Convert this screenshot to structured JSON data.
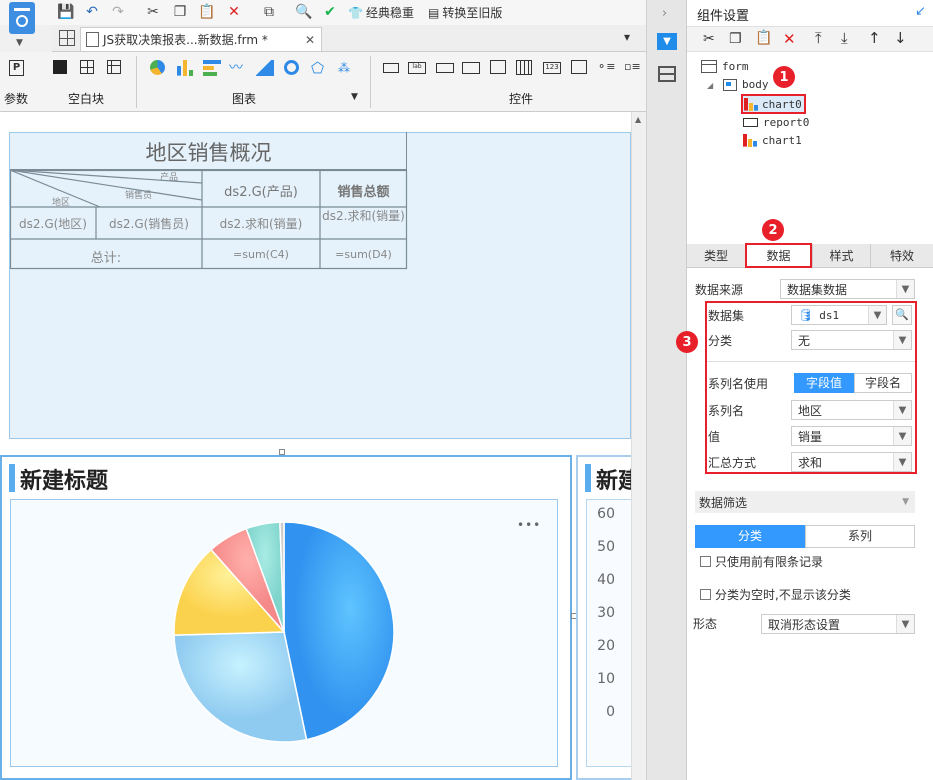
{
  "toolbar": {
    "classic_label": "经典稳重",
    "convert_label": "转换至旧版"
  },
  "tab": {
    "title": "JS获取决策报表...新数据.frm *"
  },
  "ribbon": {
    "param_label": "参数",
    "blank_label": "空白块",
    "chart_label": "图表",
    "widget_label": "控件"
  },
  "report": {
    "title": "地区销售概况",
    "diag_product": "产品",
    "diag_salesman": "销售员",
    "diag_region": "地区",
    "col_product": "ds2.G(产品)",
    "col_total": "销售总额",
    "cell_region": "ds2.G(地区)",
    "cell_salesman": "ds2.G(销售员)",
    "cell_sum": "ds2.求和(销量)",
    "cell_sum2": "ds2.求和(销量)",
    "total_label": "总计:",
    "formula1": "=sum(C4)",
    "formula2": "=sum(D4)"
  },
  "chart_left": {
    "title": "新建标题",
    "more": "•••"
  },
  "chart_right": {
    "title": "新建"
  },
  "chart_data": {
    "type": "pie",
    "values": [
      47,
      28,
      14,
      6,
      5,
      0.6
    ],
    "colors": [
      "#45a6f5",
      "#a6def8",
      "#fde36a",
      "#f99090",
      "#8fdcd6",
      "#cccccc"
    ]
  },
  "axis_ticks": [
    "60",
    "50",
    "40",
    "30",
    "20",
    "10",
    "0"
  ],
  "panel": {
    "title": "组件设置",
    "tree": {
      "form": "form",
      "body": "body",
      "chart0": "chart0",
      "report0": "report0",
      "chart1": "chart1"
    },
    "tabs": [
      "类型",
      "数据",
      "样式",
      "特效"
    ],
    "data_source_label": "数据来源",
    "data_source_value": "数据集数据",
    "dataset_label": "数据集",
    "dataset_value": "ds1",
    "category_label": "分类",
    "category_value": "无",
    "series_use_label": "系列名使用",
    "seg_field_value": "字段值",
    "seg_field_name": "字段名",
    "series_name_label": "系列名",
    "series_name_value": "地区",
    "value_label": "值",
    "value_value": "销量",
    "agg_label": "汇总方式",
    "agg_value": "求和",
    "filter_label": "数据筛选",
    "filter_tab1": "分类",
    "filter_tab2": "系列",
    "chk1": "只使用前有限条记录",
    "chk2": "分类为空时,不显示该分类",
    "form_label": "形态",
    "form_value": "取消形态设置"
  },
  "badges": [
    "1",
    "2",
    "3"
  ],
  "colors": {
    "accent": "#1e90ff",
    "badge": "#e8202a",
    "selected_tab": "#3399ff"
  }
}
